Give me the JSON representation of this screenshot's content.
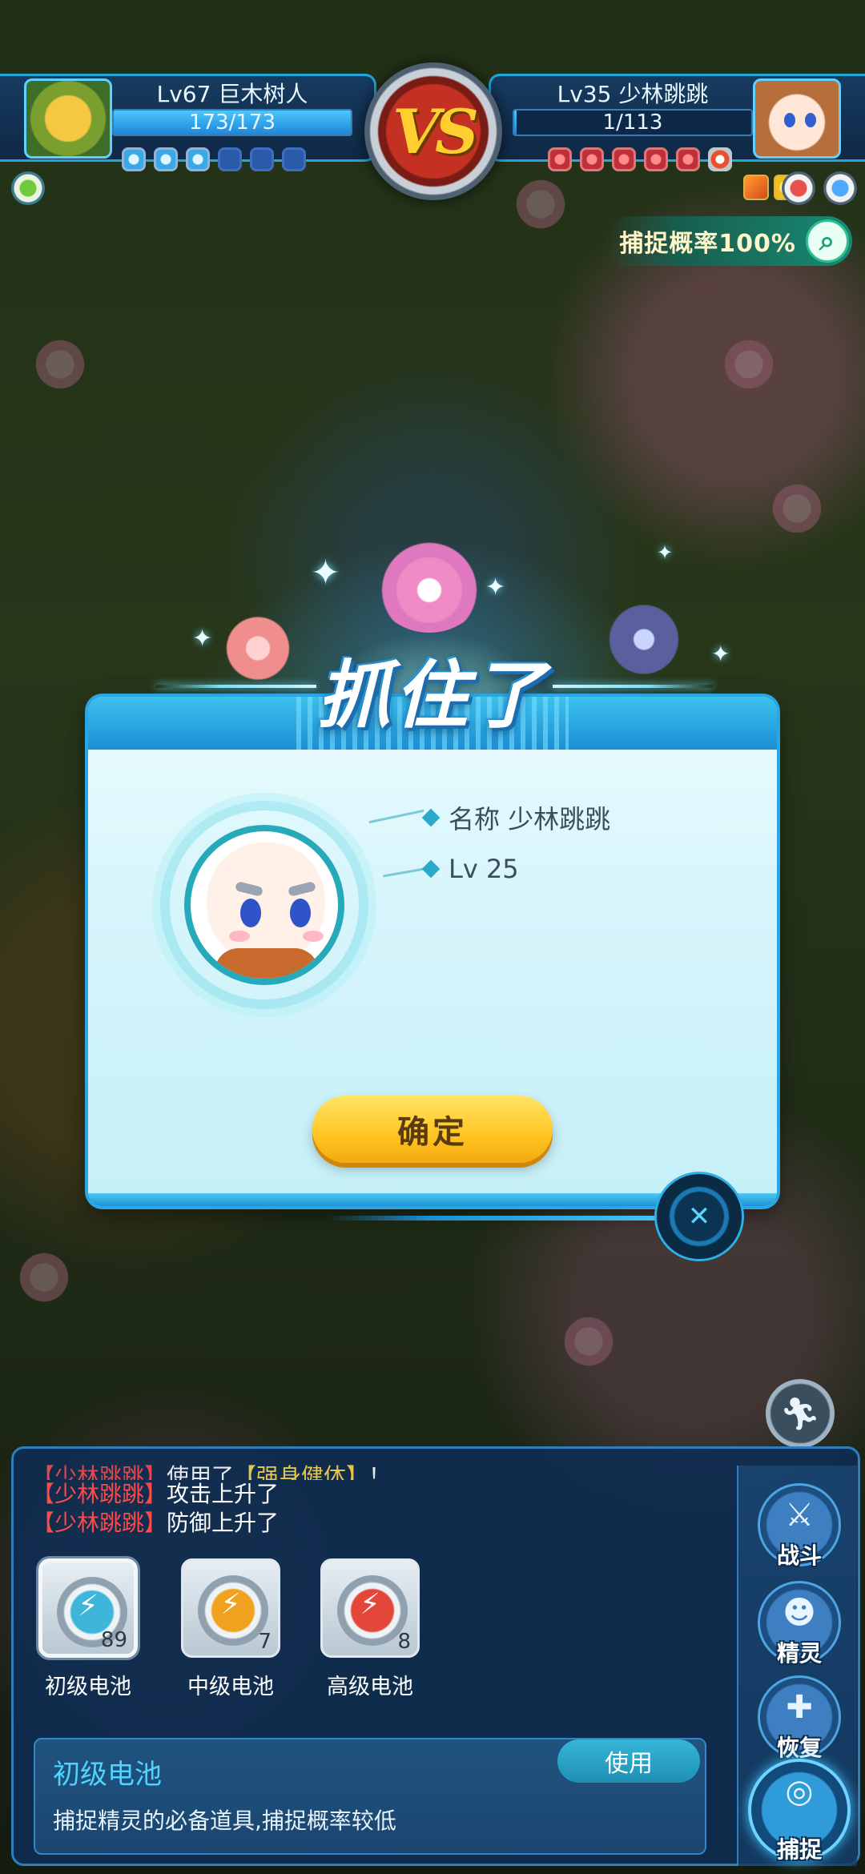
{
  "player": {
    "name": "Lv67 巨木树人",
    "hp_text": "173/173",
    "hp_fraction": 1.0
  },
  "enemy": {
    "name": "Lv35 少林跳跳",
    "hp_text": "1/113",
    "hp_fraction": 0.009
  },
  "vs_label": "VS",
  "capture_rate": "捕捉概率100%",
  "result": {
    "title": "抓住了",
    "name_line": "名称  少林跳跳",
    "level_line": "Lv 25",
    "confirm_label": "确定"
  },
  "battle_log": [
    {
      "who": "【少林跳跳】",
      "text": "使用了",
      "skill": "【强身健体】",
      "tail": "！"
    },
    {
      "who": "【少林跳跳】",
      "text": "攻击上升了",
      "skill": "",
      "tail": ""
    },
    {
      "who": "【少林跳跳】",
      "text": "防御上升了",
      "skill": "",
      "tail": ""
    }
  ],
  "items": [
    {
      "label": "初级电池",
      "count": "89",
      "color": "#3fb6d9"
    },
    {
      "label": "中级电池",
      "count": "7",
      "color": "#f0a21e"
    },
    {
      "label": "高级电池",
      "count": "8",
      "color": "#e2473a"
    }
  ],
  "selected_item": {
    "title": "初级电池",
    "description": "捕捉精灵的必备道具,捕捉概率较低",
    "use_label": "使用"
  },
  "actions": [
    {
      "label": "战斗",
      "icon": "sword-icon"
    },
    {
      "label": "精灵",
      "icon": "pet-icon"
    },
    {
      "label": "恢复",
      "icon": "potion-icon"
    },
    {
      "label": "捕捉",
      "icon": "capture-icon"
    }
  ],
  "icons": {
    "close": "close-icon",
    "run": "run-icon",
    "net": "net-icon",
    "leaf": "leaf-type-icon",
    "fist": "fist-type-icon",
    "water": "water-type-icon"
  }
}
